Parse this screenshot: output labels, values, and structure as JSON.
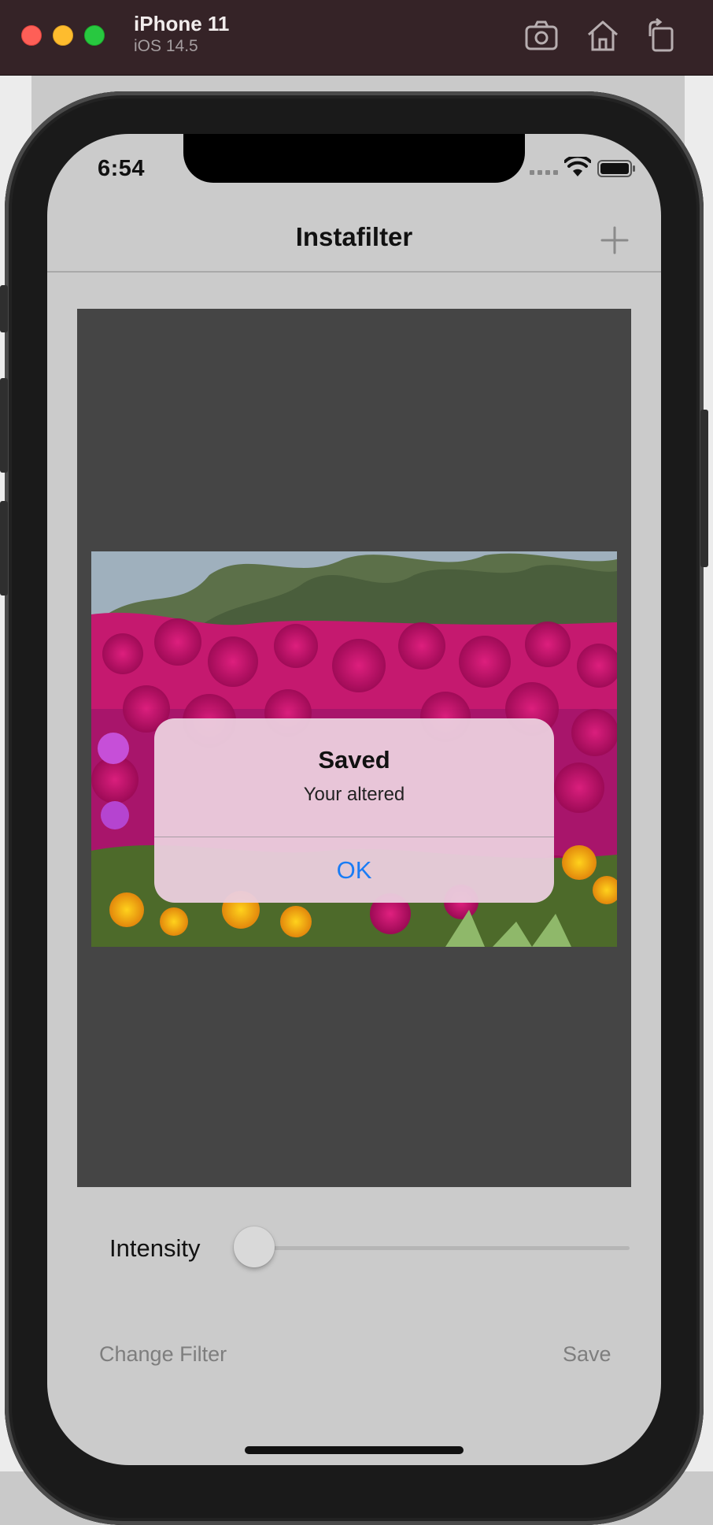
{
  "simulator": {
    "device_name": "iPhone 11",
    "os_version": "iOS 14.5",
    "toolbar_icons": [
      "screenshot-icon",
      "home-icon",
      "rotate-icon"
    ]
  },
  "status_bar": {
    "time": "6:54",
    "icons": [
      "signal-icon",
      "wifi-icon",
      "battery-icon"
    ]
  },
  "nav": {
    "title": "Instafilter",
    "add_icon": "plus-icon"
  },
  "photo": {
    "description_icon": "flower-photo"
  },
  "alert": {
    "title": "Saved",
    "message": "Your altered",
    "ok_label": "OK"
  },
  "controls": {
    "intensity_label": "Intensity",
    "intensity_value": 0,
    "change_filter_label": "Change Filter",
    "save_label": "Save"
  },
  "colors": {
    "accent": "#1a7cf5",
    "background": "#cbcbcb",
    "image_bg": "#454545"
  }
}
